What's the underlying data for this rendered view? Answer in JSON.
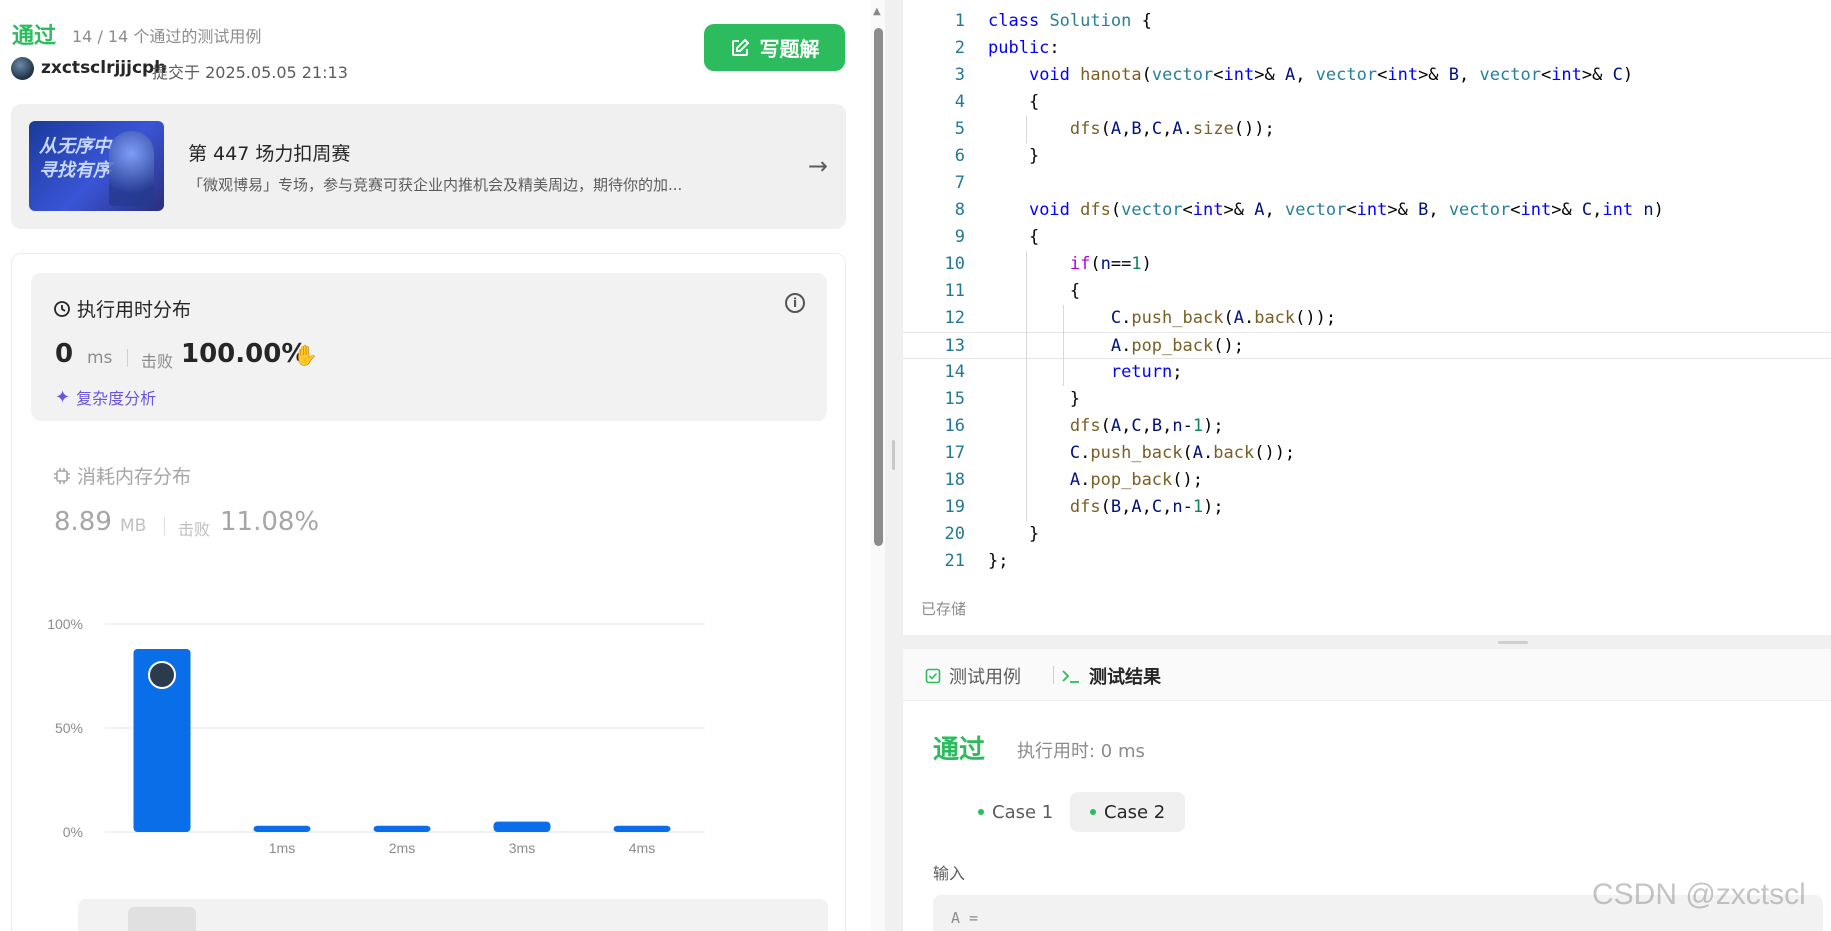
{
  "header": {
    "status": "通过",
    "testcases": "14 / 14 个通过的测试用例",
    "user": "zxctsclrjjjcph",
    "submitted": "提交于 2025.05.05 21:13",
    "write_solution": "写题解"
  },
  "promo": {
    "image_text": "从无序中 寻找有序",
    "title": "第 447 场力扣周赛",
    "desc": "「微观博易」专场，参与竞赛可获企业内推机会及精美周边，期待你的加..."
  },
  "runtime": {
    "title": "执行用时分布",
    "value": "0",
    "unit": "ms",
    "beat_label": "击败",
    "beat_value": "100.00%",
    "analysis": "复杂度分析"
  },
  "memory": {
    "title": "消耗内存分布",
    "value": "8.89",
    "unit": "MB",
    "beat_label": "击败",
    "beat_value": "11.08%"
  },
  "chart_data": {
    "type": "bar",
    "categories": [
      "0ms",
      "1ms",
      "2ms",
      "3ms",
      "4ms"
    ],
    "tick_labels": [
      "",
      "1ms",
      "2ms",
      "3ms",
      "4ms"
    ],
    "values": [
      88,
      3,
      3,
      5,
      3
    ],
    "ylim": [
      0,
      100
    ],
    "yticks": [
      "0%",
      "50%",
      "100%"
    ],
    "color": "#0a6ee8",
    "highlight_index": 0
  },
  "editor": {
    "lines": [
      "class Solution {",
      "public:",
      "    void hanota(vector<int>& A, vector<int>& B, vector<int>& C)",
      "    {",
      "        dfs(A,B,C,A.size());",
      "    }",
      "",
      "    void dfs(vector<int>& A, vector<int>& B, vector<int>& C,int n)",
      "    {",
      "        if(n==1)",
      "        {",
      "            C.push_back(A.back());",
      "            A.pop_back();",
      "            return;",
      "        }",
      "        dfs(A,C,B,n-1);",
      "        C.push_back(A.back());",
      "        A.pop_back();",
      "        dfs(B,A,C,n-1);",
      "    }",
      "};"
    ],
    "active_line": 13,
    "saved": "已存储"
  },
  "results": {
    "tab_testcase": "测试用例",
    "tab_result": "测试结果",
    "status": "通过",
    "time": "执行用时: 0 ms",
    "cases": [
      "Case 1",
      "Case 2"
    ],
    "input_label": "输入",
    "input_value": "A ="
  },
  "watermark": "CSDN @zxctscl",
  "colors": {
    "accent": "#2cbb5d",
    "bar": "#0a6ee8",
    "purple": "#6a55e0"
  }
}
